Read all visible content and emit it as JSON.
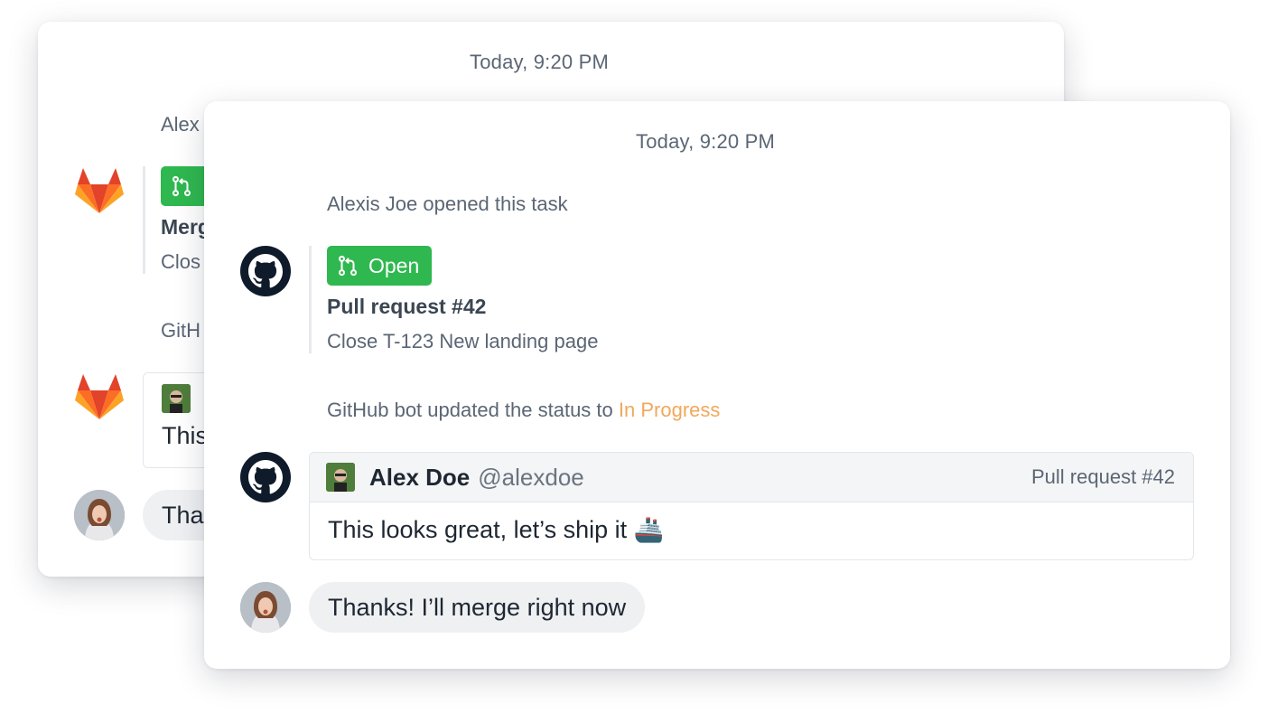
{
  "back_card": {
    "timestamp": "Today, 9:20 PM",
    "opened_text": "Alex",
    "badge_label": "",
    "pr_title": "Merg",
    "pr_subtitle": "Clos",
    "status_text": "GitH",
    "comment_text": "This",
    "reply_text": "Tha"
  },
  "front_card": {
    "timestamp": "Today, 9:20 PM",
    "opened_text": "Alexis Joe opened this task",
    "badge_label": "Open",
    "pr_title": "Pull request #42",
    "pr_subtitle": "Close T-123 New landing page",
    "status_prefix": "GitHub bot updated the status to ",
    "status_value": "In Progress",
    "comment": {
      "author": "Alex Doe",
      "handle": "@alexdoe",
      "reference": "Pull request #42",
      "body": "This looks great, let’s ship it 🚢"
    },
    "reply_text": "Thanks! I’ll merge right now"
  },
  "icons": {
    "gitlab": "gitlab-icon",
    "github": "github-icon",
    "merge": "pull-request-icon",
    "ship": "ship-emoji"
  },
  "colors": {
    "badge_green": "#2fb84f",
    "status_orange": "#f2a85a",
    "gitlab_orange": "#fc6d26",
    "github_dark": "#0f1b2a"
  }
}
